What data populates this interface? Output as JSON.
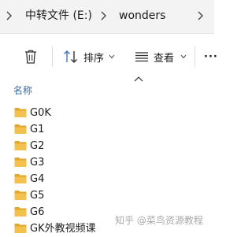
{
  "breadcrumb": {
    "items": [
      {
        "label": "中转文件 (E:)"
      },
      {
        "label": "wonders"
      }
    ]
  },
  "toolbar": {
    "delete_icon": "trash-icon",
    "sort": {
      "label": "排序",
      "icon": "sort-arrows-icon"
    },
    "view": {
      "label": "查看",
      "icon": "list-view-icon"
    },
    "more_label": "···"
  },
  "list": {
    "column_header": "名称",
    "folders": [
      {
        "name": "G0K"
      },
      {
        "name": "G1"
      },
      {
        "name": "G2"
      },
      {
        "name": "G3"
      },
      {
        "name": "G4"
      },
      {
        "name": "G5"
      },
      {
        "name": "G6"
      },
      {
        "name": "GK外教视频课"
      }
    ]
  },
  "watermark": "知乎 @菜鸟资源教程",
  "colors": {
    "folder": "#f2c14e",
    "folder_dark": "#e0a82e",
    "header_text": "#3b6aa0",
    "accent_blue": "#3e78b2"
  }
}
